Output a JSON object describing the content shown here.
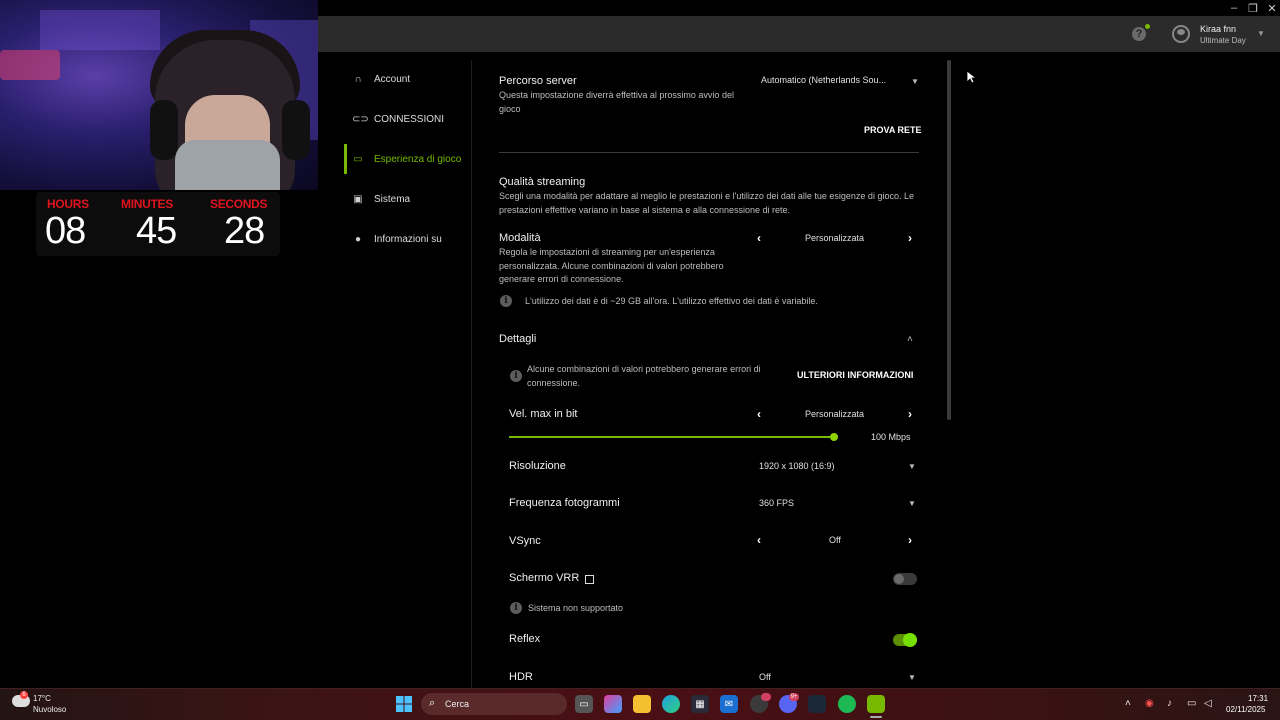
{
  "window": {
    "minimize": "–",
    "restore": "❐",
    "close": "✕"
  },
  "header": {
    "user_name": "Kiraa fnn",
    "user_tier": "Ultimate Day",
    "help": "?"
  },
  "timer": {
    "hours_label": "HOURS",
    "minutes_label": "MINUTES",
    "seconds_label": "SECONDS",
    "hours": "08",
    "minutes": "45",
    "seconds": "28"
  },
  "sidebar": {
    "items": [
      {
        "label": "Account",
        "icon": "headset-icon"
      },
      {
        "label": "CONNESSIONI",
        "icon": "link-icon"
      },
      {
        "label": "Esperienza di gioco",
        "icon": "monitor-icon",
        "active": true
      },
      {
        "label": "Sistema",
        "icon": "devices-icon"
      },
      {
        "label": "Informazioni su",
        "icon": "info-icon"
      }
    ]
  },
  "server": {
    "title": "Percorso server",
    "desc": "Questa impostazione diverrà effettiva al prossimo avvio del gioco",
    "value": "Automatico (Netherlands Sou...",
    "test_button": "PROVA RETE"
  },
  "quality": {
    "title": "Qualità streaming",
    "desc": "Scegli una modalità per adattare al meglio le prestazioni e l'utilizzo dei dati alle tue esigenze di gioco. Le prestazioni effettive variano in base al sistema e alla connessione di rete."
  },
  "mode": {
    "title": "Modalità",
    "desc": "Regola le impostazioni di streaming per un'esperienza personalizzata. Alcune combinazioni di valori potrebbero generare errori di connessione.",
    "value": "Personalizzata",
    "data_note": "L'utilizzo dei dati è di ~29 GB all'ora. L'utilizzo effettivo dei dati è variabile."
  },
  "details": {
    "title": "Dettagli",
    "warning": "Alcune combinazioni di valori potrebbero generare errori di connessione.",
    "more_info": "ULTERIORI INFORMAZIONI"
  },
  "bitrate": {
    "label": "Vel. max in bit",
    "value": "Personalizzata",
    "amount": "100 Mbps",
    "fill_fraction": 1.0
  },
  "resolution": {
    "label": "Risoluzione",
    "value": "1920 x 1080 (16:9)"
  },
  "fps": {
    "label": "Frequenza fotogrammi",
    "value": "360 FPS"
  },
  "vsync": {
    "label": "VSync",
    "value": "Off"
  },
  "vrr": {
    "label": "Schermo VRR",
    "note": "Sistema non supportato",
    "enabled": false
  },
  "reflex": {
    "label": "Reflex",
    "enabled": true
  },
  "hdr": {
    "label": "HDR",
    "value": "Off"
  },
  "taskbar": {
    "temperature": "17°C",
    "weather": "Nuvoloso",
    "search_placeholder": "Cerca",
    "time": "17:31",
    "date": "02/11/2025",
    "badge_count": "9+"
  }
}
